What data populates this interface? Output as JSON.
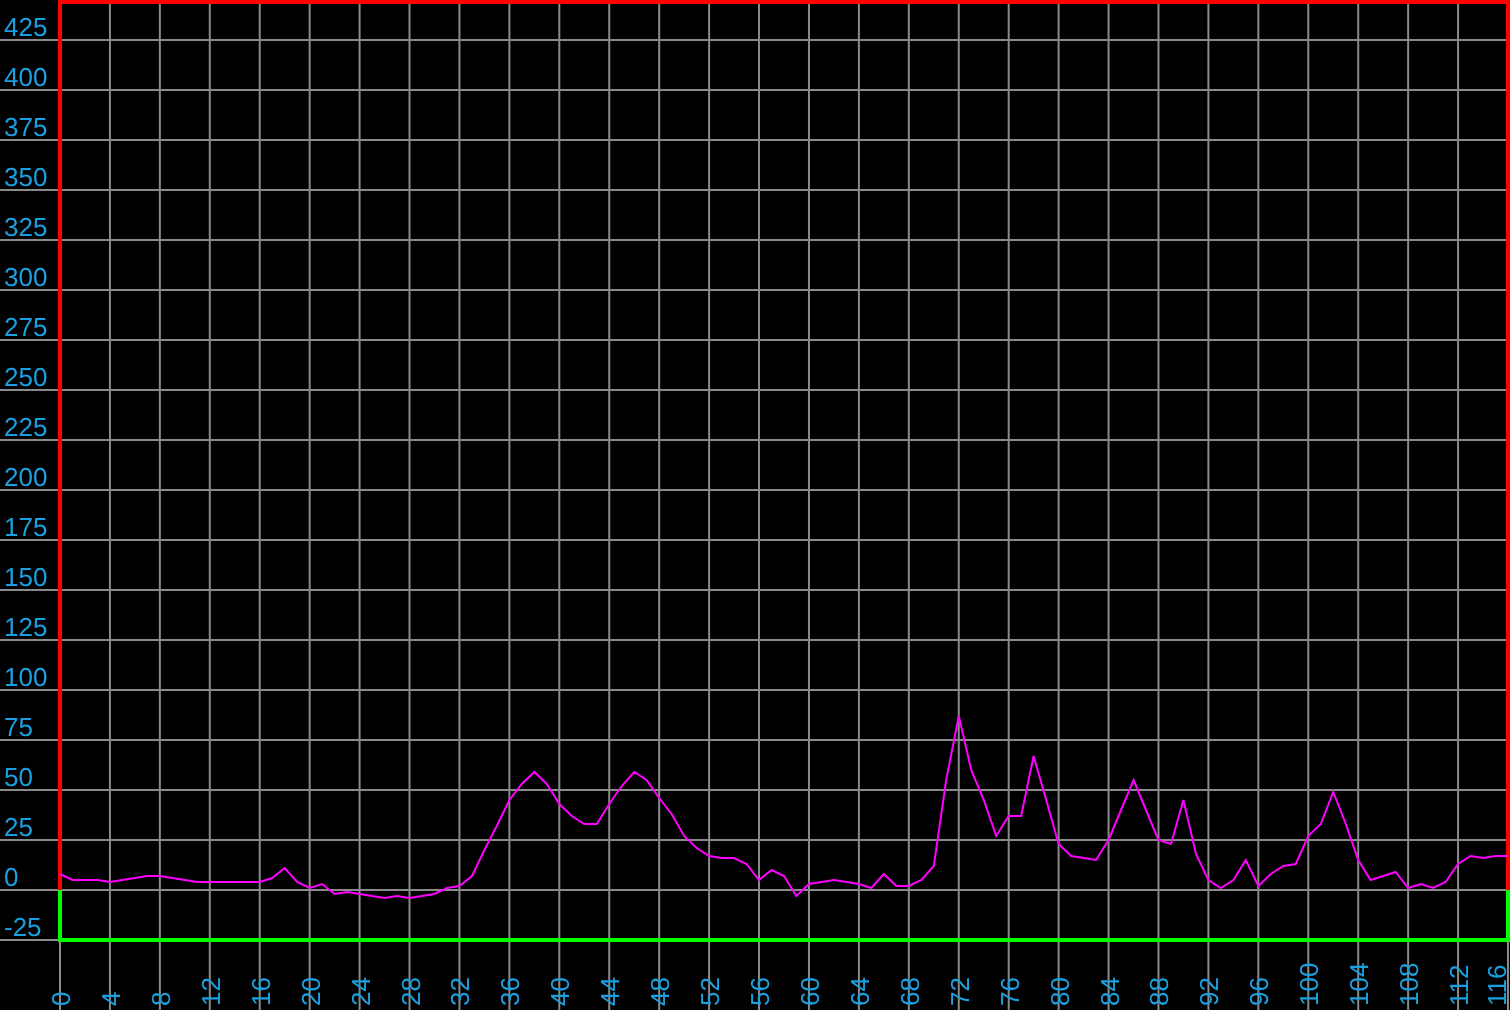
{
  "chart_data": {
    "type": "line",
    "x": [
      0,
      1,
      2,
      3,
      4,
      5,
      6,
      7,
      8,
      9,
      10,
      11,
      12,
      13,
      14,
      15,
      16,
      17,
      18,
      19,
      20,
      21,
      22,
      23,
      24,
      25,
      26,
      27,
      28,
      29,
      30,
      31,
      32,
      33,
      34,
      35,
      36,
      37,
      38,
      39,
      40,
      41,
      42,
      43,
      44,
      45,
      46,
      47,
      48,
      49,
      50,
      51,
      52,
      53,
      54,
      55,
      56,
      57,
      58,
      59,
      60,
      61,
      62,
      63,
      64,
      65,
      66,
      67,
      68,
      69,
      70,
      71,
      72,
      73,
      74,
      75,
      76,
      77,
      78,
      79,
      80,
      81,
      82,
      83,
      84,
      85,
      86,
      87,
      88,
      89,
      90,
      91,
      92,
      93,
      94,
      95,
      96,
      97,
      98,
      99,
      100,
      101,
      102,
      103,
      104,
      105,
      106,
      107,
      108,
      109,
      110,
      111,
      112,
      113,
      114,
      115,
      116
    ],
    "series": [
      {
        "color": "#ff00ff",
        "values": [
          8,
          5,
          5,
          5,
          4,
          5,
          6,
          7,
          7,
          6,
          5,
          4,
          4,
          4,
          4,
          4,
          4,
          6,
          11,
          4,
          1,
          3,
          -2,
          -1,
          -2,
          -3,
          -4,
          -3,
          -4,
          -3,
          -2,
          1,
          2,
          7,
          20,
          32,
          45,
          53,
          59,
          53,
          43,
          37,
          33,
          33,
          43,
          52,
          59,
          55,
          46,
          38,
          27,
          21,
          17,
          16,
          16,
          13,
          5,
          10,
          7,
          -3,
          3,
          4,
          5,
          4,
          3,
          1,
          8,
          2,
          2,
          5,
          12,
          55,
          87,
          60,
          45,
          27,
          37,
          37,
          67,
          45,
          23,
          17,
          16,
          15,
          25,
          40,
          55,
          40,
          25,
          23,
          45,
          18,
          5,
          1,
          5,
          15,
          2,
          8,
          12,
          13,
          27,
          33,
          49,
          33,
          15,
          5,
          7,
          9,
          1,
          3,
          1,
          4,
          13,
          17,
          16,
          17,
          17
        ]
      }
    ],
    "grid": true,
    "xlim": [
      0,
      116
    ],
    "ylim": [
      -25,
      444
    ],
    "xticks": [
      0,
      4,
      8,
      12,
      16,
      20,
      24,
      28,
      32,
      36,
      40,
      44,
      48,
      52,
      56,
      60,
      64,
      68,
      72,
      76,
      80,
      84,
      88,
      92,
      96,
      100,
      104,
      108,
      112,
      116
    ],
    "yticks": [
      -25,
      0,
      25,
      50,
      75,
      100,
      125,
      150,
      175,
      200,
      225,
      250,
      275,
      300,
      325,
      350,
      375,
      400,
      425
    ]
  }
}
